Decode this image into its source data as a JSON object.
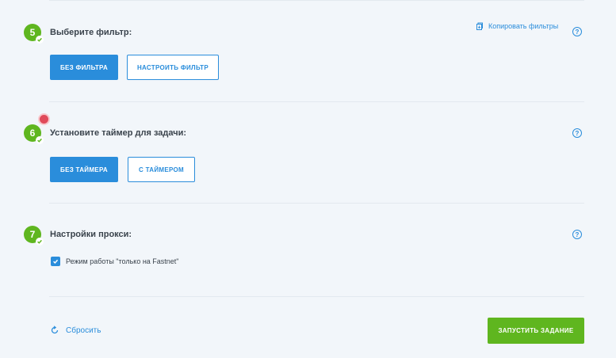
{
  "steps": [
    {
      "number": "5",
      "title": "Выберите фильтр:",
      "buttons": [
        "Без фильтра",
        "Настроить фильтр"
      ],
      "copy_link": "Копировать фильтры"
    },
    {
      "number": "6",
      "title": "Установите таймер для задачи:",
      "buttons": [
        "Без таймера",
        "С таймером"
      ]
    },
    {
      "number": "7",
      "title": "Настройки прокси:",
      "checkbox_label": "Режим работы \"только на Fastnet\"",
      "checkbox_checked": true
    }
  ],
  "help_glyph": "?",
  "footer": {
    "reset_label": "Сбросить",
    "run_label": "Запустить задание"
  },
  "colors": {
    "accent": "#2a8ddb",
    "success": "#5fb61f",
    "alert": "#e04a5a",
    "background": "#f2f6fa"
  },
  "icons": {
    "copy": "copy-icon",
    "help": "help-icon",
    "check": "check-icon",
    "reset": "reset-icon"
  }
}
